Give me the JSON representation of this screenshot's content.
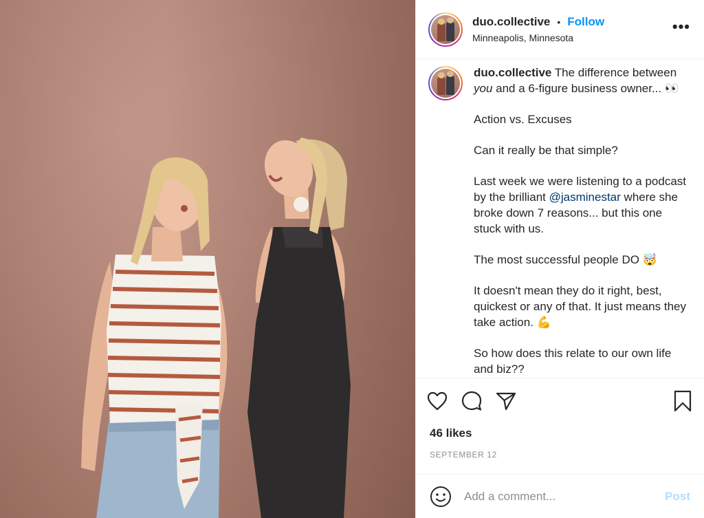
{
  "post": {
    "username": "duo.collective",
    "separator": "•",
    "follow_label": "Follow",
    "location": "Minneapolis, Minnesota",
    "more_label": "•••",
    "caption": {
      "username": "duo.collective",
      "line1_text": " The difference between ",
      "line1_italic": "you",
      "line1_rest": " and a 6-figure business owner... 👀",
      "para2": "Action vs. Excuses",
      "para3": "Can it really be that simple?",
      "para4_before": "Last week we were listening to a podcast by the brilliant ",
      "para4_mention": "@jasminestar",
      "para4_after": " where she broke down 7 reasons... but this one stuck with us.",
      "para5": "The most successful people DO 🤯",
      "para6": "It doesn't mean they do it right, best, quickest or any of that. It just means they take action. 💪",
      "para7": "So how does this relate to our own life and biz??"
    },
    "likes": "46 likes",
    "date": "SEPTEMBER 12",
    "comment_placeholder": "Add a comment...",
    "post_label": "Post"
  },
  "icons": {
    "like": "heart-icon",
    "comment": "comment-icon",
    "share": "paper-plane-icon",
    "save": "bookmark-icon",
    "emoji": "smiley-icon",
    "more": "more-options-icon"
  },
  "colors": {
    "accent": "#0095f6",
    "mention": "#00376b",
    "muted": "#8e8e8e",
    "post_disabled": "#b2dffc",
    "backdrop": "#b48678"
  }
}
